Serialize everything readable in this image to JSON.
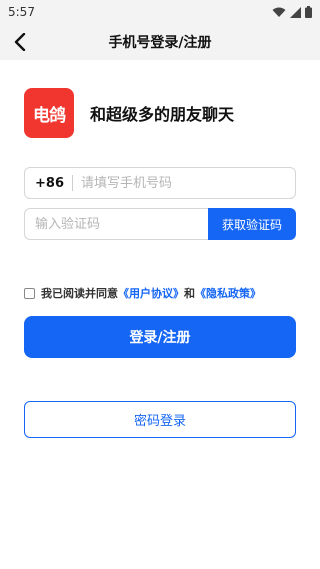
{
  "status_bar": {
    "time": "5:57",
    "icons": [
      "wifi-icon",
      "signal-icon",
      "battery-icon"
    ]
  },
  "nav": {
    "title": "手机号登录/注册",
    "back_icon": "chevron-left-icon"
  },
  "app": {
    "logo_text": "电鸽",
    "slogan": "和超级多的朋友聊天",
    "logo_color": "#f0362f"
  },
  "form": {
    "country_code": "+86",
    "phone_placeholder": "请填写手机号码",
    "code_placeholder": "输入验证码",
    "get_code_label": "获取验证码"
  },
  "agreement": {
    "prefix": "我已阅读并同意",
    "user_agreement": "《用户协议》",
    "and": "和",
    "privacy_policy": "《隐私政策》",
    "checked": false
  },
  "buttons": {
    "login_label": "登录/注册",
    "password_login_label": "密码登录"
  },
  "colors": {
    "accent": "#1566f5",
    "background": "#ffffff",
    "bar_background": "#f3f3f3"
  }
}
